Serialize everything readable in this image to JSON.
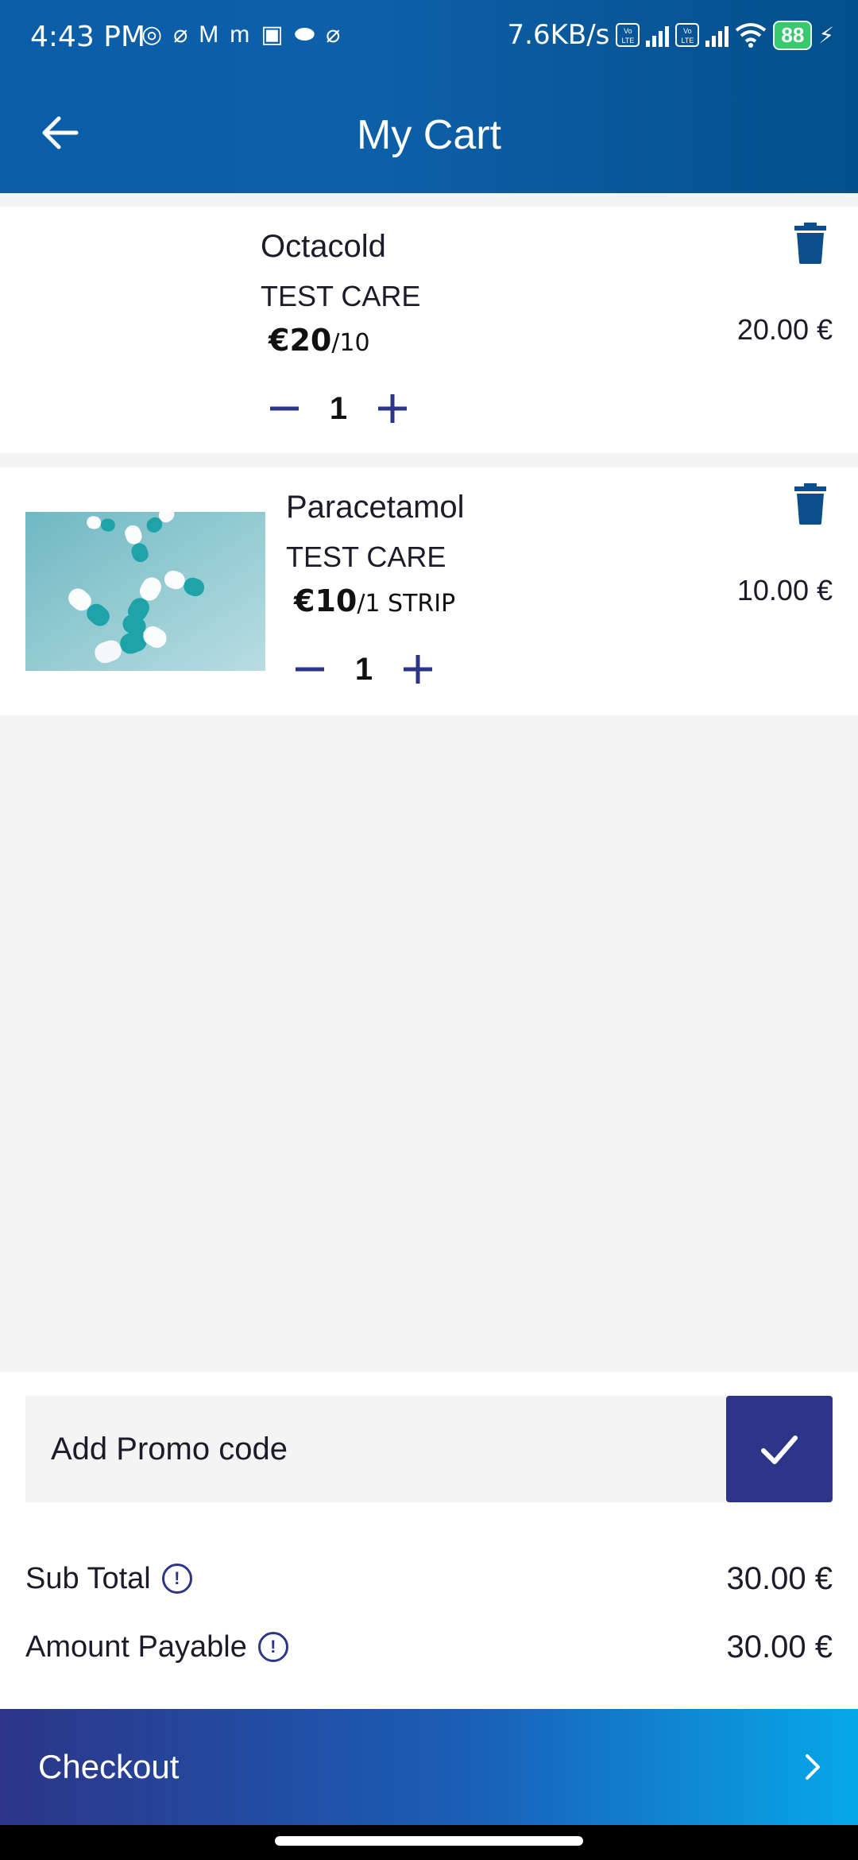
{
  "status_bar": {
    "time": "4:43 PM",
    "network_speed": "7.6KB/s",
    "battery": "88",
    "volte_label": "Vo LTE"
  },
  "header": {
    "title": "My Cart",
    "back_icon": "arrow-left-icon"
  },
  "cart": {
    "items": [
      {
        "name": "Octacold",
        "brand": "TEST CARE",
        "price": "€20",
        "unit": "/10",
        "quantity": "1",
        "line_total": "20.00 €",
        "has_image": false
      },
      {
        "name": "Paracetamol",
        "brand": "TEST CARE",
        "price": "€10",
        "unit": "/1 STRIP",
        "quantity": "1",
        "line_total": "10.00 €",
        "has_image": true
      }
    ]
  },
  "promo": {
    "placeholder": "Add Promo code",
    "apply_icon": "check-icon"
  },
  "summary": {
    "subtotal_label": "Sub Total",
    "subtotal_value": "30.00 €",
    "payable_label": "Amount Payable",
    "payable_value": "30.00 €"
  },
  "checkout": {
    "label": "Checkout"
  },
  "colors": {
    "header": "#0a5ea8",
    "accent": "#2c3587",
    "delete_icon": "#0c4f8c",
    "checkout_end": "#06a8e8"
  }
}
